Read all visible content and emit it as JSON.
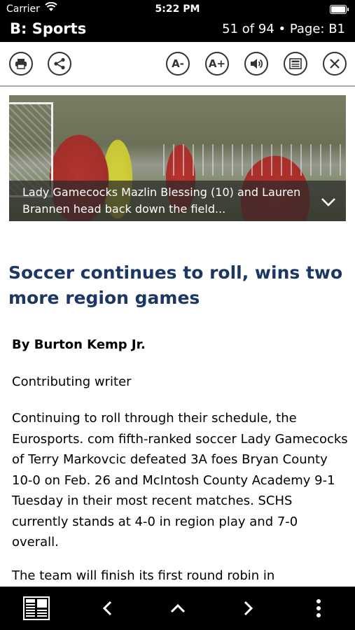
{
  "status_bar": {
    "carrier": "Carrier",
    "time": "5:22 PM",
    "battery_level": 1.0
  },
  "title_bar": {
    "section": "B: Sports",
    "page_info": "51 of 94 • Page: B1"
  },
  "toolbar": {
    "print_icon": "printer-icon",
    "share_icon": "share-icon",
    "font_smaller_label": "A-",
    "font_larger_label": "A+",
    "audio_icon": "speaker-icon",
    "page_view_icon": "newspaper-icon",
    "close_icon": "close-icon"
  },
  "photo": {
    "caption": "Lady Gamecocks Mazlin Blessing (10) and Lauren Brannen head back down the field...",
    "expand_icon": "chevron-down-icon"
  },
  "article": {
    "headline": "Soccer continues to roll, wins two more region games",
    "byline": "By Burton Kemp Jr.",
    "role": "Contributing writer",
    "paragraphs": [
      "Continuing to roll through their schedule, the Eurosports. com fifth-ranked soccer Lady Gamecocks of Terry Markovcic defeated 3A foes Bryan County 10-0 on Feb. 26 and McIntosh County Academy 9-1 Tuesday in their most recent matches. SCHS currently stands at 4-0 in region play and 7-0 overall.",
      "The team will finish its first round robin in"
    ]
  },
  "bottom_bar": {
    "pages_icon": "newspaper-pages-icon",
    "prev_icon": "chevron-left-icon",
    "up_icon": "chevron-up-icon",
    "next_icon": "chevron-right-icon",
    "more_icon": "more-vertical-icon"
  }
}
